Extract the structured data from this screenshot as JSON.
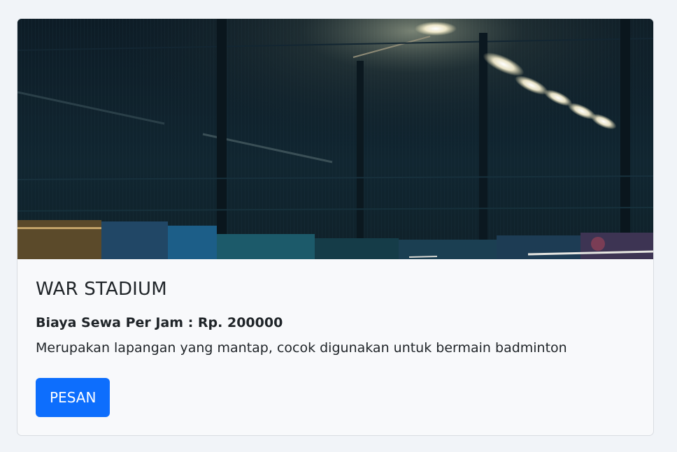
{
  "card": {
    "title": "WAR STADIUM",
    "price": "Biaya Sewa Per Jam : Rp. 200000",
    "description": "Merupakan lapangan yang mantap, cocok digunakan untuk bermain badminton",
    "button_label": "PESAN"
  },
  "colors": {
    "button": "#0d6efd",
    "background": "#f1f4f8",
    "card_background": "#f8f9fb",
    "text": "#1f2428"
  }
}
